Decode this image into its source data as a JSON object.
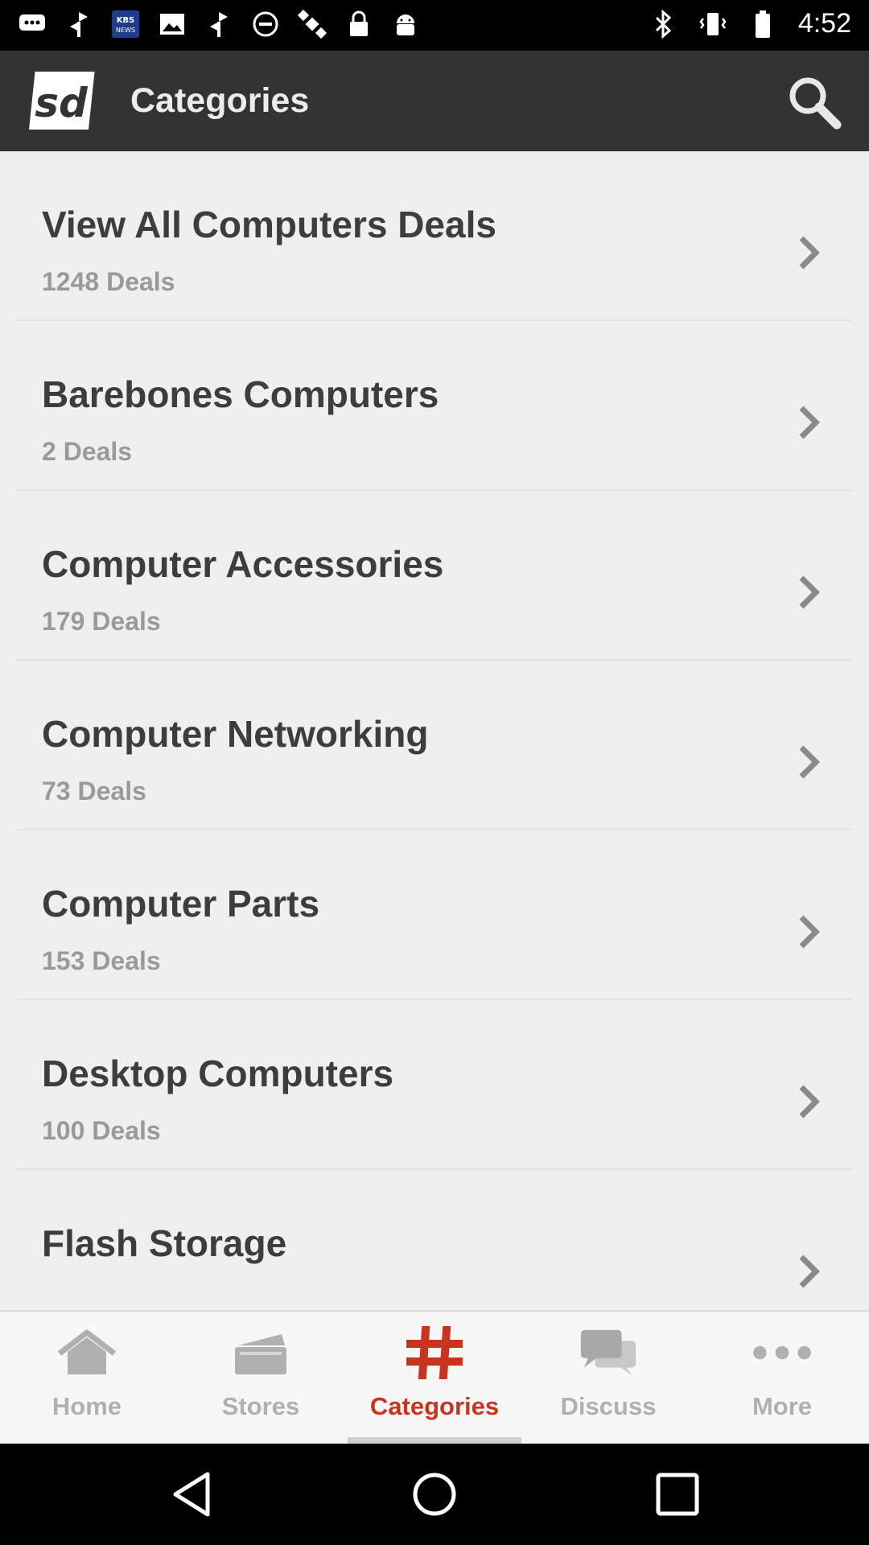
{
  "status_bar": {
    "time": "4:52",
    "left_icons": [
      "chat-icon",
      "pinwheel-icon",
      "kbs-news-icon",
      "image-icon",
      "pinwheel-icon",
      "do-not-disturb-icon",
      "satellite-icon",
      "lock-icon",
      "android-icon"
    ],
    "right_icons": [
      "bluetooth-icon",
      "vibrate-icon",
      "battery-icon"
    ]
  },
  "header": {
    "logo_text": "sd",
    "title": "Categories"
  },
  "categories": [
    {
      "title": "View All Computers Deals",
      "count": "1248 Deals"
    },
    {
      "title": "Barebones Computers",
      "count": "2 Deals"
    },
    {
      "title": "Computer Accessories",
      "count": "179 Deals"
    },
    {
      "title": "Computer Networking",
      "count": "73 Deals"
    },
    {
      "title": "Computer Parts",
      "count": "153 Deals"
    },
    {
      "title": "Desktop Computers",
      "count": "100 Deals"
    },
    {
      "title": "Flash Storage",
      "count": ""
    }
  ],
  "bottom_nav": {
    "tabs": [
      {
        "label": "Home",
        "icon": "home-icon"
      },
      {
        "label": "Stores",
        "icon": "stores-icon"
      },
      {
        "label": "Categories",
        "icon": "hashtag-icon",
        "active": true
      },
      {
        "label": "Discuss",
        "icon": "chat-bubbles-icon"
      },
      {
        "label": "More",
        "icon": "more-dots-icon"
      }
    ]
  },
  "colors": {
    "app_bar": "#333333",
    "accent": "#c9341f",
    "background": "#efefef"
  }
}
